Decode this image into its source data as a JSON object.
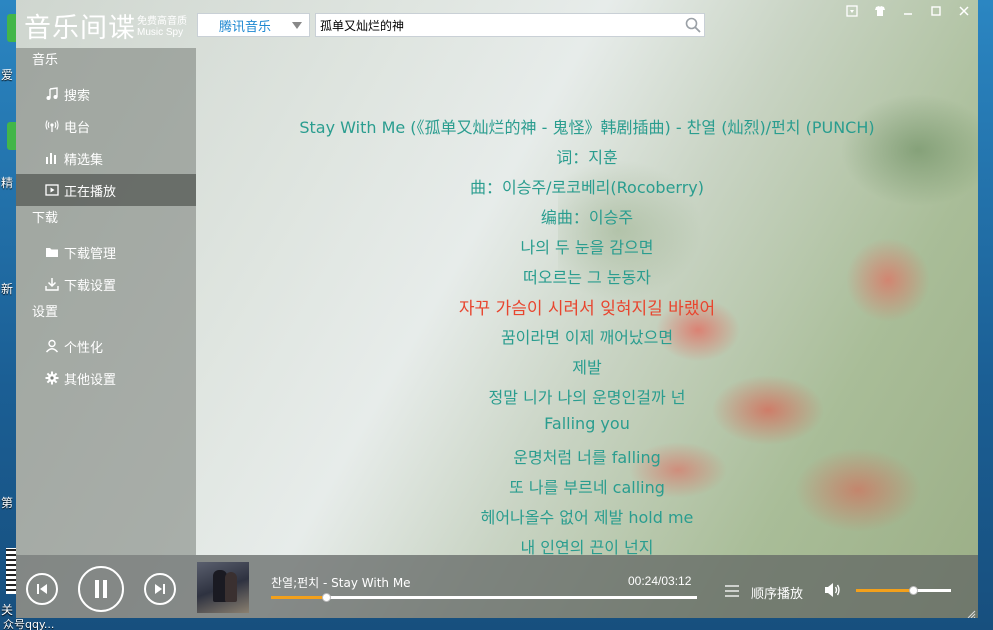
{
  "desktop": {
    "labels": [
      "爱",
      "精",
      "新",
      "第",
      "关",
      "众号qqy..."
    ]
  },
  "app": {
    "title": "音乐间谍",
    "subtitle_cn": "免费高音质",
    "subtitle_en": "Music Spy"
  },
  "search": {
    "source": "腾讯音乐",
    "query": "孤单又灿烂的神"
  },
  "sidebar": {
    "sections": [
      {
        "title": "音乐",
        "items": [
          {
            "label": "搜索",
            "icon": "music-note-icon"
          },
          {
            "label": "电台",
            "icon": "radio-icon"
          },
          {
            "label": "精选集",
            "icon": "chart-bars-icon"
          },
          {
            "label": "正在播放",
            "icon": "play-screen-icon",
            "active": true
          }
        ]
      },
      {
        "title": "下载",
        "items": [
          {
            "label": "下载管理",
            "icon": "folder-icon"
          },
          {
            "label": "下载设置",
            "icon": "download-icon"
          }
        ]
      },
      {
        "title": "设置",
        "items": [
          {
            "label": "个性化",
            "icon": "user-icon"
          },
          {
            "label": "其他设置",
            "icon": "gear-icon"
          }
        ]
      }
    ]
  },
  "lyrics": {
    "current_index": 6,
    "lines": [
      "Stay With Me (《孤单又灿烂的神 - 鬼怪》韩剧插曲)  - 찬열 (灿烈)/펀치 (PUNCH)",
      "词：지훈",
      "曲：이승주/로코베리(Rocoberry)",
      "编曲：이승주",
      "나의 두 눈을 감으면",
      "떠오르는 그 눈동자",
      "자꾸 가슴이 시려서 잊혀지길 바랬어",
      "꿈이라면 이제 깨어났으면",
      "제발",
      "정말 니가 나의 운명인걸까 넌",
      "Falling you",
      "운명처럼 너를 falling",
      "또 나를 부르네 calling",
      "헤어나올수 없어 제발 hold me",
      "내 인연의 끈이 넌지"
    ]
  },
  "player": {
    "song": "찬열;펀치 - Stay With Me",
    "time": "00:24/03:12",
    "progress_fraction": 0.13,
    "mode": "顺序播放",
    "volume_fraction": 0.6,
    "accent_color": "#f3a01b"
  },
  "colors": {
    "lyric": "#2a9d8f",
    "lyric_current": "#e8452e",
    "source_text": "#1e88d1"
  }
}
